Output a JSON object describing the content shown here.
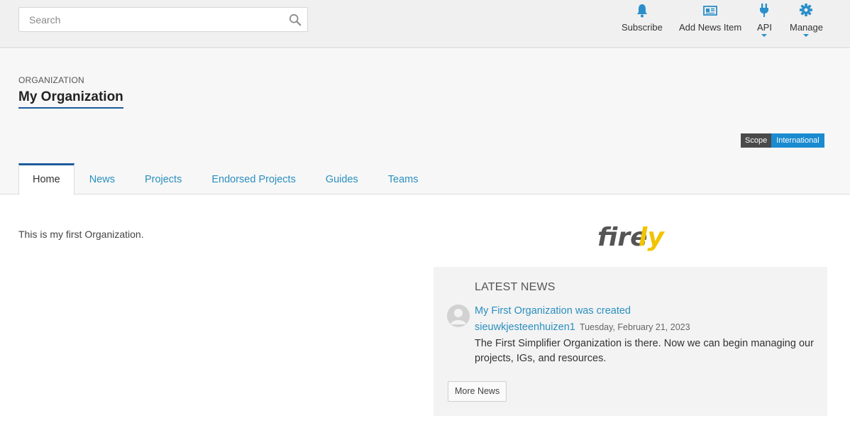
{
  "search": {
    "placeholder": "Search"
  },
  "topnav": {
    "subscribe": "Subscribe",
    "add_news": "Add News Item",
    "api": "API",
    "manage": "Manage"
  },
  "org": {
    "kicker": "ORGANIZATION",
    "title": "My Organization"
  },
  "scope": {
    "key": "Scope",
    "value": "International"
  },
  "tabs": [
    "Home",
    "News",
    "Projects",
    "Endorsed Projects",
    "Guides",
    "Teams"
  ],
  "intro": "This is my first Organization.",
  "logo": {
    "text_dark": "fire",
    "text_accent": "ly"
  },
  "news": {
    "heading": "LATEST NEWS",
    "title": "My First Organization was created",
    "author": "sieuwkjesteenhuizen1",
    "date": "Tuesday, February 21, 2023",
    "body": "The First Simplifier Organization is there. Now we can begin managing our projects, IGs, and resources.",
    "more_label": "More News"
  },
  "colors": {
    "accent": "#2a8fbf",
    "brand": "#1e5b9c",
    "scope_value": "#1a8bd0",
    "logo_accent": "#f2c400"
  }
}
